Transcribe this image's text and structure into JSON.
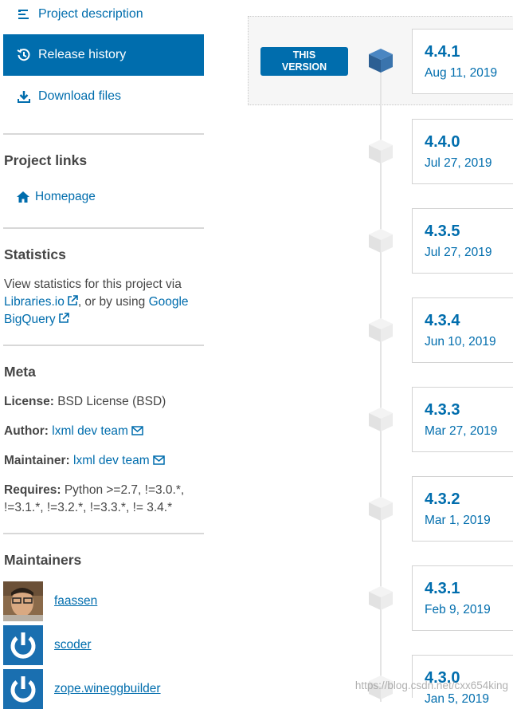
{
  "sidebar": {
    "nav": [
      {
        "label": "Project description",
        "icon": "align-left-icon"
      },
      {
        "label": "Release history",
        "icon": "history-icon",
        "active": true
      },
      {
        "label": "Download files",
        "icon": "download-icon"
      }
    ],
    "project_links": {
      "heading": "Project links",
      "homepage_label": "Homepage"
    },
    "statistics": {
      "heading": "Statistics",
      "text_before": "View statistics for this project via",
      "libraries_link": "Libraries.io",
      "text_middle": ", or by using",
      "google_link_1": "Google",
      "google_link_2": "BigQuery"
    },
    "meta": {
      "heading": "Meta",
      "license_label": "License:",
      "license_value": "BSD License (BSD)",
      "author_label": "Author:",
      "author_value": "lxml dev team",
      "maintainer_label": "Maintainer:",
      "maintainer_value": "lxml dev team",
      "requires_label": "Requires:",
      "requires_value_1": "Python >=2.7, !=3.0.*,",
      "requires_value_2": "!=3.1.*, !=3.2.*, !=3.3.*, != 3.4.*"
    },
    "maintainers": {
      "heading": "Maintainers",
      "users": [
        "faassen",
        "scoder",
        "zope.wineggbuilder"
      ]
    }
  },
  "timeline": {
    "this_version_line1": "THIS",
    "this_version_line2": "VERSION",
    "releases": [
      {
        "version": "4.4.1",
        "date": "Aug 11, 2019"
      },
      {
        "version": "4.4.0",
        "date": "Jul 27, 2019"
      },
      {
        "version": "4.3.5",
        "date": "Jul 27, 2019"
      },
      {
        "version": "4.3.4",
        "date": "Jun 10, 2019"
      },
      {
        "version": "4.3.3",
        "date": "Mar 27, 2019"
      },
      {
        "version": "4.3.2",
        "date": "Mar 1, 2019"
      },
      {
        "version": "4.3.1",
        "date": "Feb 9, 2019"
      },
      {
        "version": "4.3.0",
        "date": "Jan 5, 2019"
      }
    ]
  },
  "watermark": "https://blog.csdn.net/cxx654king",
  "colors": {
    "accent": "#006dad",
    "text": "#464646",
    "divider": "#d8d8d8"
  }
}
